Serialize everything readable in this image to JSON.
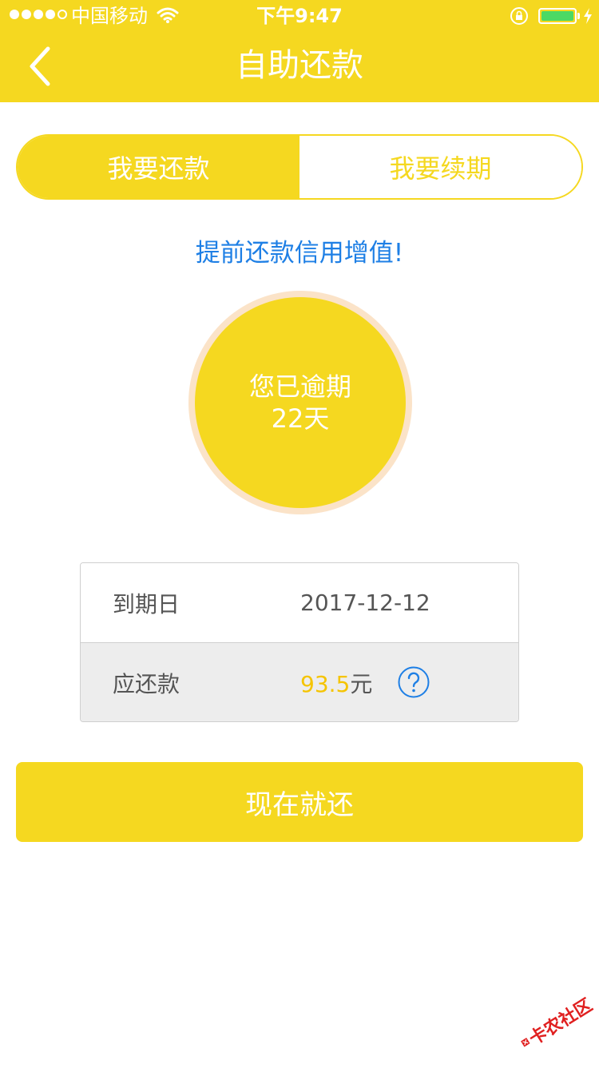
{
  "status_bar": {
    "carrier": "中国移动",
    "time": "下午9:47"
  },
  "nav": {
    "title": "自助还款",
    "back_icon": "chevron-left-icon"
  },
  "segments": [
    {
      "label": "我要还款",
      "active": true
    },
    {
      "label": "我要续期",
      "active": false
    }
  ],
  "promo_text": "提前还款信用增值!",
  "overdue": {
    "line1": "您已逾期",
    "line2": "22天"
  },
  "info": {
    "due_label": "到期日",
    "due_value": "2017-12-12",
    "amount_label": "应还款",
    "amount_value": "93.5",
    "amount_unit": "元",
    "help_icon": "question-circle-icon"
  },
  "pay_button_label": "现在就还",
  "watermark_text": "卡农社区",
  "colors": {
    "brand_yellow": "#F5D820",
    "link_blue": "#1E7FE5",
    "amount_yellow": "#F5C400",
    "circle_halo": "#FBE3C8"
  }
}
